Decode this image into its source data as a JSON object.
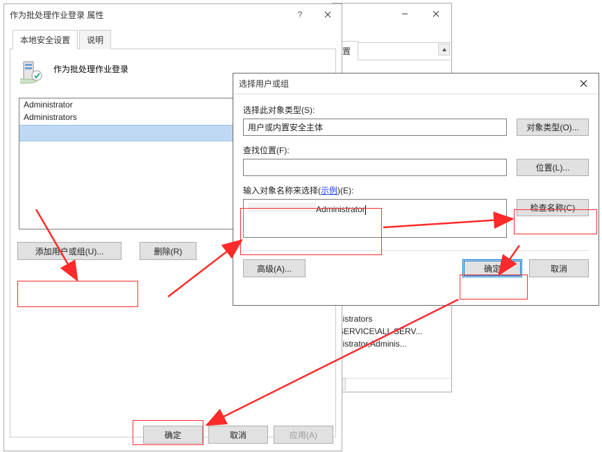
{
  "bgWindow": {
    "title": "",
    "tab_label": "置",
    "list": [
      "nistrators",
      "SERVICE\\ALL SERV...",
      "nistrator,Adminis..."
    ]
  },
  "propWindow": {
    "title": "作为批处理作业登录 属性",
    "tabs": {
      "local": "本地安全设置",
      "explain": "说明"
    },
    "policy_name": "作为批处理作业登录",
    "list_items": [
      "Administrator",
      "Administrators"
    ],
    "btn_add": "添加用户或组(U)...",
    "btn_remove": "删除(R)",
    "btn_ok": "确定",
    "btn_cancel": "取消",
    "btn_apply": "应用(A)"
  },
  "selectDialog": {
    "title": "选择用户或组",
    "lbl_object_type": "选择此对象类型(S):",
    "val_object_type": "用户或内置安全主体",
    "btn_object_types": "对象类型(O)...",
    "lbl_location": "查找位置(F):",
    "val_location": " ",
    "btn_locations": "位置(L)...",
    "lbl_names_pre": "输入对象名称来选择(",
    "lbl_names_link": "示例",
    "lbl_names_post": ")(E):",
    "val_names_right": "Administrator",
    "btn_check_names": "检查名称(C)",
    "btn_advanced": "高级(A)...",
    "btn_ok": "确定",
    "btn_cancel": "取消"
  }
}
